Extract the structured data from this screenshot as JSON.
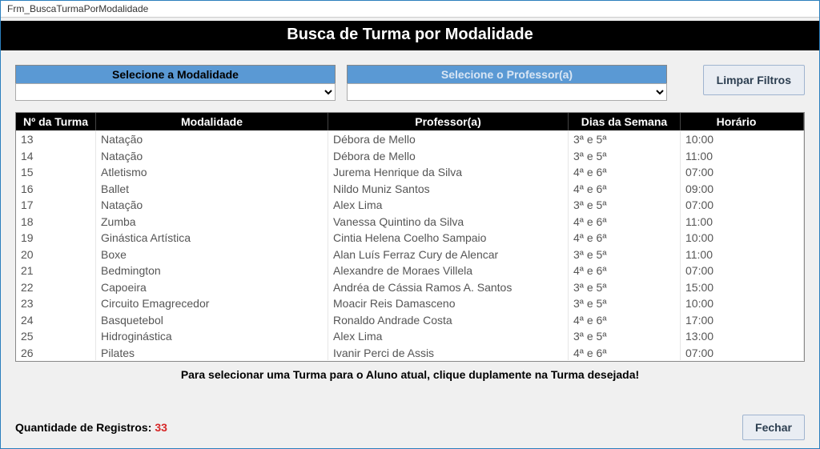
{
  "window_title": "Frm_BuscaTurmaPorModalidade",
  "header_title": "Busca de Turma por Modalidade",
  "filters": {
    "modalidade_label": "Selecione a Modalidade",
    "professor_label": "Selecione o Professor(a)",
    "modalidade_value": "",
    "professor_value": "",
    "limpar_label": "Limpar Filtros"
  },
  "columns": {
    "num": "Nº da Turma",
    "modalidade": "Modalidade",
    "professor": "Professor(a)",
    "dias": "Dias da Semana",
    "horario": "Horário"
  },
  "rows": [
    {
      "num": "13",
      "modalidade": "Natação",
      "professor": "Débora de Mello",
      "dias": "3ª e 5ª",
      "horario": "10:00"
    },
    {
      "num": "14",
      "modalidade": "Natação",
      "professor": "Débora de Mello",
      "dias": "3ª e 5ª",
      "horario": "11:00"
    },
    {
      "num": "15",
      "modalidade": "Atletismo",
      "professor": "Jurema Henrique da Silva",
      "dias": "4ª e 6ª",
      "horario": "07:00"
    },
    {
      "num": "16",
      "modalidade": "Ballet",
      "professor": "Nildo Muniz Santos",
      "dias": "4ª e 6ª",
      "horario": "09:00"
    },
    {
      "num": "17",
      "modalidade": "Natação",
      "professor": "Alex Lima",
      "dias": "3ª e 5ª",
      "horario": "07:00"
    },
    {
      "num": "18",
      "modalidade": "Zumba",
      "professor": "Vanessa Quintino da Silva",
      "dias": "4ª e 6ª",
      "horario": "11:00"
    },
    {
      "num": "19",
      "modalidade": "Ginástica Artística",
      "professor": "Cintia Helena Coelho Sampaio",
      "dias": "4ª e 6ª",
      "horario": "10:00"
    },
    {
      "num": "20",
      "modalidade": "Boxe",
      "professor": "Alan Luís Ferraz Cury de Alencar",
      "dias": "3ª e 5ª",
      "horario": "11:00"
    },
    {
      "num": "21",
      "modalidade": "Bedmington",
      "professor": "Alexandre de Moraes Villela",
      "dias": "4ª e 6ª",
      "horario": "07:00"
    },
    {
      "num": "22",
      "modalidade": "Capoeira",
      "professor": "Andréa de Cássia Ramos A. Santos",
      "dias": "3ª e 5ª",
      "horario": "15:00"
    },
    {
      "num": "23",
      "modalidade": "Circuito Emagrecedor",
      "professor": "Moacir Reis Damasceno",
      "dias": "3ª e 5ª",
      "horario": "10:00"
    },
    {
      "num": "24",
      "modalidade": "Basquetebol",
      "professor": "Ronaldo Andrade Costa",
      "dias": "4ª e 6ª",
      "horario": "17:00"
    },
    {
      "num": "25",
      "modalidade": "Hidroginástica",
      "professor": "Alex Lima",
      "dias": "3ª e 5ª",
      "horario": "13:00"
    },
    {
      "num": "26",
      "modalidade": "Pilates",
      "professor": "Ivanir Perci de Assis",
      "dias": "4ª e 6ª",
      "horario": "07:00"
    }
  ],
  "instruction_text": "Para selecionar uma Turma para o Aluno atual, clique duplamente na Turma desejada!",
  "footer": {
    "reg_label": "Quantidade de Registros:",
    "reg_count": "33",
    "fechar_label": "Fechar"
  }
}
